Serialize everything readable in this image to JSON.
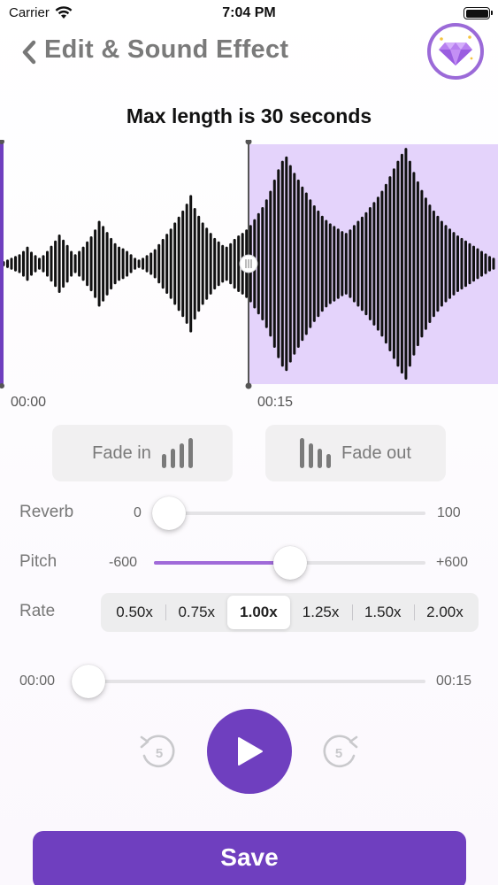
{
  "status_bar": {
    "carrier": "Carrier",
    "time": "7:04 PM"
  },
  "nav": {
    "title": "Edit & Sound Effect",
    "back_icon": "chevron-left-icon",
    "badge_icon": "diamond-icon"
  },
  "max_length_text": "Max length is 30 seconds",
  "waveform": {
    "start_time": "00:00",
    "mid_time": "00:15",
    "selection_start_fraction": 0.5,
    "selection_color": "#e4d3fb",
    "bar_color": "#111111"
  },
  "fade": {
    "fade_in_label": "Fade in",
    "fade_out_label": "Fade out"
  },
  "reverb": {
    "label": "Reverb",
    "min": "0",
    "max": "100",
    "value": 0
  },
  "pitch": {
    "label": "Pitch",
    "min": "-600",
    "max": "+600",
    "value": 0
  },
  "rate": {
    "label": "Rate",
    "options": [
      "0.50x",
      "0.75x",
      "1.00x",
      "1.25x",
      "1.50x",
      "2.00x"
    ],
    "selected": "1.00x"
  },
  "playback": {
    "current_time": "00:00",
    "total_time": "00:15",
    "progress_fraction": 0
  },
  "controls": {
    "rewind_seconds": "5",
    "forward_seconds": "5"
  },
  "save_label": "Save",
  "colors": {
    "accent": "#6f3fbf",
    "slider_fill": "#a06ad9"
  }
}
